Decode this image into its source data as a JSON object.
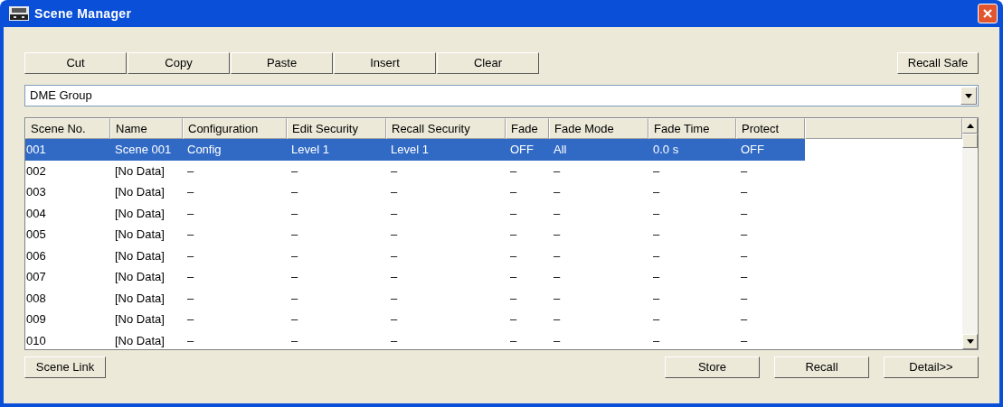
{
  "window": {
    "title": "Scene Manager"
  },
  "toolbar": {
    "buttons": [
      "Cut",
      "Copy",
      "Paste",
      "Insert",
      "Clear"
    ],
    "right_button": "Recall Safe"
  },
  "group_select": {
    "value": "DME Group"
  },
  "table": {
    "columns": [
      "Scene No.",
      "Name",
      "Configuration",
      "Edit Security",
      "Recall Security",
      "Fade",
      "Fade Mode",
      "Fade Time",
      "Protect"
    ],
    "rows": [
      {
        "selected": true,
        "cells": [
          "001",
          "Scene 001",
          "Config",
          "Level 1",
          "Level 1",
          "OFF",
          "All",
          "0.0 s",
          "OFF"
        ]
      },
      {
        "selected": false,
        "cells": [
          "002",
          "[No Data]",
          "–",
          "–",
          "–",
          "–",
          "–",
          "–",
          "–"
        ]
      },
      {
        "selected": false,
        "cells": [
          "003",
          "[No Data]",
          "–",
          "–",
          "–",
          "–",
          "–",
          "–",
          "–"
        ]
      },
      {
        "selected": false,
        "cells": [
          "004",
          "[No Data]",
          "–",
          "–",
          "–",
          "–",
          "–",
          "–",
          "–"
        ]
      },
      {
        "selected": false,
        "cells": [
          "005",
          "[No Data]",
          "–",
          "–",
          "–",
          "–",
          "–",
          "–",
          "–"
        ]
      },
      {
        "selected": false,
        "cells": [
          "006",
          "[No Data]",
          "–",
          "–",
          "–",
          "–",
          "–",
          "–",
          "–"
        ]
      },
      {
        "selected": false,
        "cells": [
          "007",
          "[No Data]",
          "–",
          "–",
          "–",
          "–",
          "–",
          "–",
          "–"
        ]
      },
      {
        "selected": false,
        "cells": [
          "008",
          "[No Data]",
          "–",
          "–",
          "–",
          "–",
          "–",
          "–",
          "–"
        ]
      },
      {
        "selected": false,
        "cells": [
          "009",
          "[No Data]",
          "–",
          "–",
          "–",
          "–",
          "–",
          "–",
          "–"
        ]
      },
      {
        "selected": false,
        "cells": [
          "010",
          "[No Data]",
          "–",
          "–",
          "–",
          "–",
          "–",
          "–",
          "–"
        ]
      }
    ]
  },
  "bottom": {
    "left_button": "Scene Link",
    "right_buttons": [
      "Store",
      "Recall",
      "Detail>>"
    ]
  }
}
